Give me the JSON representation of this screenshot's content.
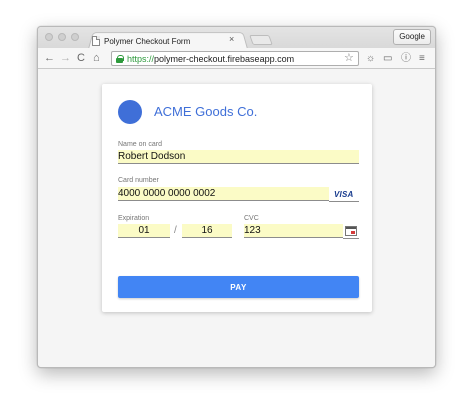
{
  "browser": {
    "tab_title": "Polymer Checkout Form",
    "tab_close": "×",
    "profile_label": "Google",
    "url_scheme": "https://",
    "url_rest": "polymer-checkout.firebaseapp.com",
    "icons": {
      "back": "←",
      "forward": "→",
      "reload": "C",
      "home": "⌂",
      "star": "☆",
      "extension": "☼",
      "cast": "▭",
      "info": "ⓘ",
      "menu": "≡"
    }
  },
  "checkout": {
    "company_name": "ACME Goods Co.",
    "name_label": "Name on card",
    "name_value": "Robert Dodson",
    "card_label": "Card number",
    "card_value": "4000 0000 0000 0002",
    "card_brand": "VISA",
    "expiration_label": "Expiration",
    "exp_month": "01",
    "exp_separator": "/",
    "exp_year": "16",
    "cvc_label": "CVC",
    "cvc_value": "123",
    "pay_label": "PAY"
  },
  "colors": {
    "accent": "#3f6fd8",
    "button": "#4285f4",
    "autofill": "#fbfbc6"
  }
}
